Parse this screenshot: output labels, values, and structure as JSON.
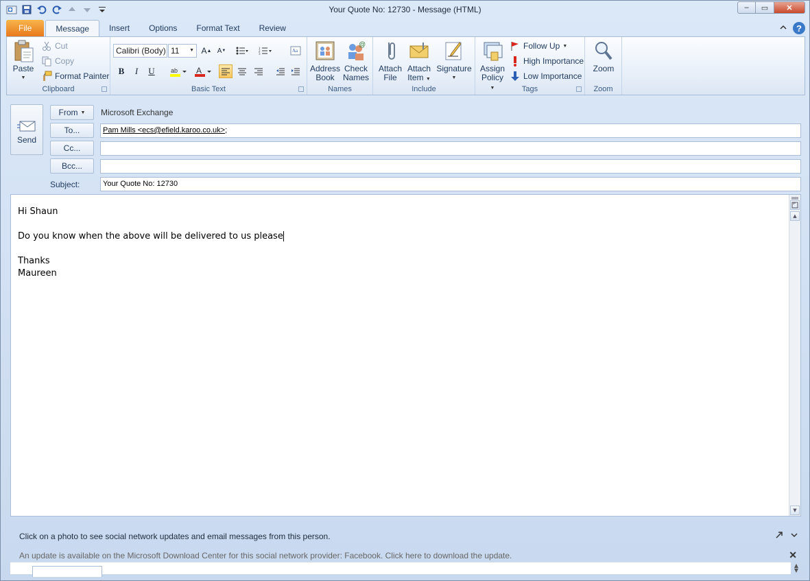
{
  "window": {
    "title": "Your Quote No:  12730  -  Message (HTML)",
    "controls": {
      "minimize": "–",
      "maximize": "▭",
      "close": "✕"
    }
  },
  "qat_icons": [
    "outlook-icon",
    "save-icon",
    "undo-icon",
    "redo-icon",
    "previous-icon",
    "next-icon",
    "customize-icon"
  ],
  "tabs": [
    {
      "label": "File"
    },
    {
      "label": "Message"
    },
    {
      "label": "Insert"
    },
    {
      "label": "Options"
    },
    {
      "label": "Format Text"
    },
    {
      "label": "Review"
    }
  ],
  "ribbon": {
    "clipboard": {
      "label": "Clipboard",
      "paste": "Paste",
      "cut": "Cut",
      "copy": "Copy",
      "format_painter": "Format Painter"
    },
    "basic_text": {
      "label": "Basic Text",
      "font_name": "Calibri (Body)",
      "font_size": "11",
      "bold": "B",
      "italic": "I",
      "underline": "U"
    },
    "names": {
      "label": "Names",
      "address_book_1": "Address",
      "address_book_2": "Book",
      "check_names_1": "Check",
      "check_names_2": "Names"
    },
    "include": {
      "label": "Include",
      "attach_file_1": "Attach",
      "attach_file_2": "File",
      "attach_item_1": "Attach",
      "attach_item_2": "Item",
      "signature": "Signature"
    },
    "tags": {
      "label": "Tags",
      "assign_policy_1": "Assign",
      "assign_policy_2": "Policy",
      "follow_up": "Follow Up",
      "high_importance": "High Importance",
      "low_importance": "Low Importance"
    },
    "zoom": {
      "label": "Zoom",
      "zoom": "Zoom"
    }
  },
  "header": {
    "send": "Send",
    "from_button": "From",
    "from_value": "Microsoft Exchange",
    "to_button": "To...",
    "to_value": "Pam Mills <ecs@efield.karoo.co.uk>",
    "to_suffix": ";",
    "cc_button": "Cc...",
    "cc_value": "",
    "bcc_button": "Bcc...",
    "bcc_value": "",
    "subject_label": "Subject:",
    "subject_value": "Your Quote No:  12730"
  },
  "body": {
    "line1": "Hi Shaun",
    "line2": "Do you know when the above will be delivered to us please",
    "line3": "Thanks",
    "line4": "Maureen"
  },
  "people_pane": {
    "message": "Click on a photo to see social network updates and email messages from this person.",
    "update": "An update is available on the Microsoft Download Center for this social network provider: Facebook. Click here to download the update."
  },
  "colors": {
    "file_tab": "#e8781c",
    "ribbon_bg": "#e6eef8",
    "highlight": "#f8c55e",
    "text_color_red": "#d9261c",
    "highlight_yellow": "#ffff00"
  }
}
